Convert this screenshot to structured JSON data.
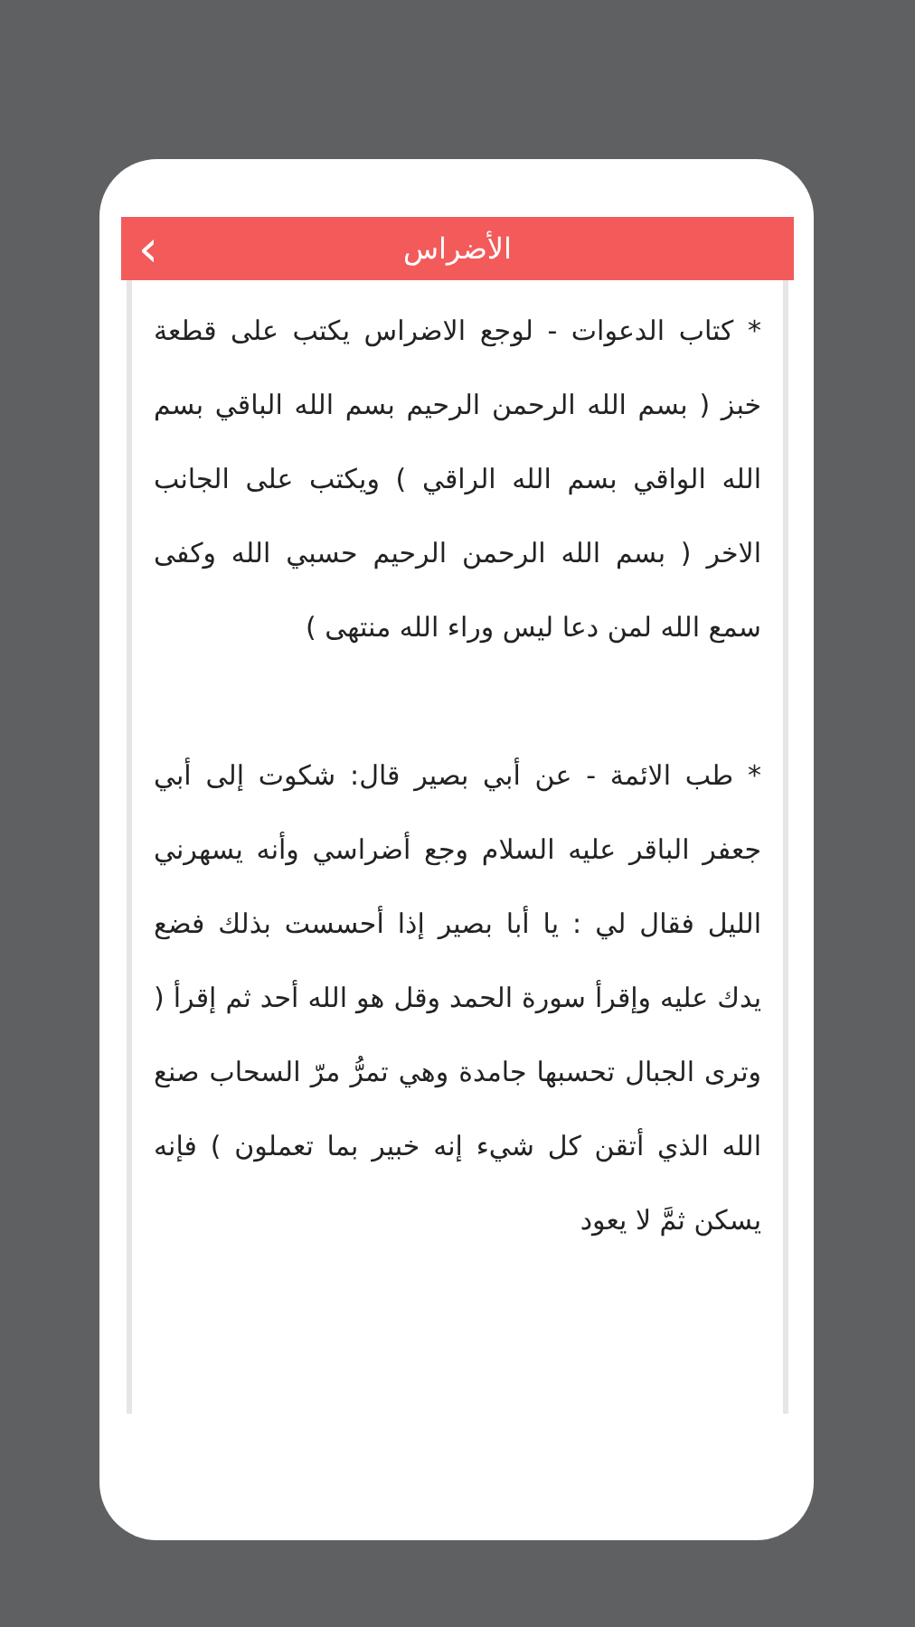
{
  "header": {
    "title": "الأضراس",
    "back_icon": "‹"
  },
  "paragraphs": [
    "* كتاب الدعوات - لوجع الاضراس يكتب على قطعة خبز ( بسم الله الرحمن الرحيم بسم الله الباقي بسم الله الواقي بسم الله الراقي ) ويكتب على الجانب الاخر ( بسم الله الرحمن الرحيم حسبي الله وكفى سمع الله لمن دعا ليس وراء الله منتهى )",
    "* طب الائمة - عن أبي بصير قال: شكوت إلى أبي جعفر الباقر عليه السلام وجع أضراسي وأنه يسهرني الليل فقال لي : يا أبا بصير إذا أحسست بذلك فضع يدك عليه وإقرأ سورة الحمد وقل هو الله أحد ثم إقرأ ( وترى الجبال تحسبها جامدة وهي تمرُّ مرّ السحاب صنع الله الذي أتقن كل شيء إنه خبير بما تعملون ) فإنه يسكن ثمَّ لا يعود"
  ]
}
